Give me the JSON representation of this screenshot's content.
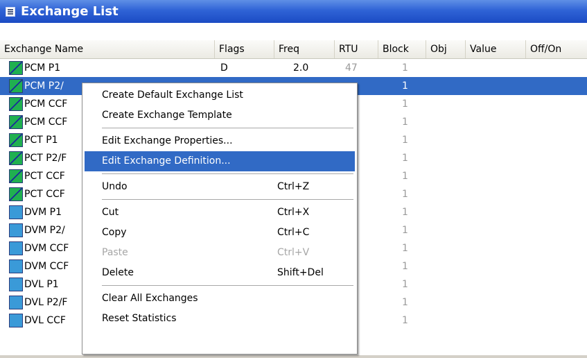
{
  "window": {
    "title": "Exchange List"
  },
  "columns": [
    "Exchange Name",
    "Flags",
    "Freq",
    "RTU",
    "Block",
    "Obj",
    "Value",
    "Off/On"
  ],
  "rows": [
    {
      "name": "PCM P1",
      "icon": "pcm",
      "flags": "D",
      "freq": "2.0",
      "rtu": "47",
      "block": "1"
    },
    {
      "name": "PCM P2/",
      "icon": "pcm",
      "flags": "",
      "freq": "",
      "rtu": "",
      "block": "1",
      "selected": true
    },
    {
      "name": "PCM CCF",
      "icon": "pcm",
      "flags": "",
      "freq": "",
      "rtu": "",
      "block": "1"
    },
    {
      "name": "PCM CCF",
      "icon": "pcm",
      "flags": "",
      "freq": "",
      "rtu": "",
      "block": "1"
    },
    {
      "name": "PCT P1",
      "icon": "pcm",
      "flags": "",
      "freq": "",
      "rtu": "",
      "block": "1"
    },
    {
      "name": "PCT P2/F",
      "icon": "pcm",
      "flags": "",
      "freq": "",
      "rtu": "",
      "block": "1"
    },
    {
      "name": "PCT CCF",
      "icon": "pcm",
      "flags": "",
      "freq": "",
      "rtu": "",
      "block": "1"
    },
    {
      "name": "PCT CCF",
      "icon": "pcm",
      "flags": "",
      "freq": "",
      "rtu": "",
      "block": "1"
    },
    {
      "name": "DVM P1",
      "icon": "dvm",
      "flags": "",
      "freq": "",
      "rtu": "",
      "block": "1"
    },
    {
      "name": "DVM P2/",
      "icon": "dvm",
      "flags": "",
      "freq": "",
      "rtu": "",
      "block": "1"
    },
    {
      "name": "DVM CCF",
      "icon": "dvm",
      "flags": "",
      "freq": "",
      "rtu": "",
      "block": "1"
    },
    {
      "name": "DVM CCF",
      "icon": "dvm",
      "flags": "",
      "freq": "",
      "rtu": "",
      "block": "1"
    },
    {
      "name": "DVL P1",
      "icon": "dvl",
      "flags": "",
      "freq": "",
      "rtu": "",
      "block": "1"
    },
    {
      "name": "DVL P2/F",
      "icon": "dvl",
      "flags": "",
      "freq": "",
      "rtu": "",
      "block": "1"
    },
    {
      "name": "DVL CCF",
      "icon": "dvl",
      "flags": "",
      "freq": "",
      "rtu": "",
      "block": "1"
    }
  ],
  "context_menu": {
    "items": [
      {
        "label": "Create Default Exchange List"
      },
      {
        "label": "Create Exchange Template"
      },
      {
        "separator": true
      },
      {
        "label": "Edit Exchange Properties..."
      },
      {
        "label": "Edit Exchange Definition...",
        "highlighted": true
      },
      {
        "separator": true
      },
      {
        "label": "Undo",
        "shortcut": "Ctrl+Z"
      },
      {
        "separator": true
      },
      {
        "label": "Cut",
        "shortcut": "Ctrl+X"
      },
      {
        "label": "Copy",
        "shortcut": "Ctrl+C"
      },
      {
        "label": "Paste",
        "shortcut": "Ctrl+V",
        "disabled": true
      },
      {
        "label": "Delete",
        "shortcut": "Shift+Del"
      },
      {
        "separator": true
      },
      {
        "label": "Clear All Exchanges"
      },
      {
        "label": "Reset Statistics"
      }
    ]
  },
  "colors": {
    "titlebar": "#2f63d6",
    "selection": "#316ac5"
  }
}
